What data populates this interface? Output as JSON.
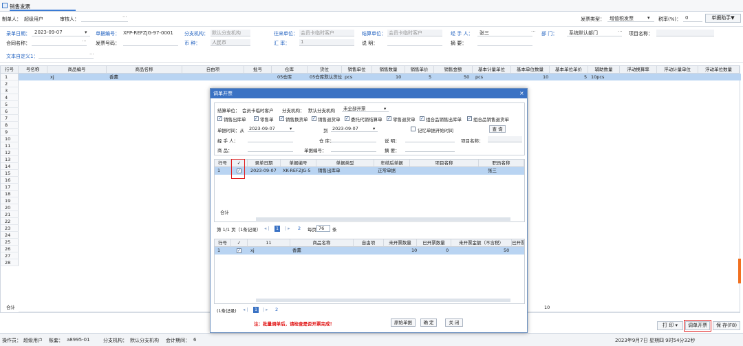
{
  "window": {
    "title": "销售发票"
  },
  "header": {
    "maker_label": "制单人：",
    "maker_value": "超级用户",
    "auditor_label": "审核人：",
    "invoice_type_label": "发票类型：",
    "invoice_type_value": "增值税发票",
    "tax_label": "税率(%)：",
    "tax_value": "0",
    "assist_btn": "单据助手▼"
  },
  "form": {
    "record_date_label": "录单日期：",
    "record_date_value": "2023-09-07",
    "doc_no_label": "单据编号：",
    "doc_no_value": "XFP-REFZJG-97-0001",
    "branch_label": "分支机构：",
    "branch_value": "默认分支机构",
    "partner_label": "往来单位：",
    "partner_value": "会员卡临时客户",
    "settle_label": "结算单位：",
    "settle_value": "会员卡临时客户",
    "handler_label": "经 手 人：",
    "handler_value": "张三",
    "dept_label": "部 门：",
    "dept_value": "系统默认部门",
    "project_label": "项目名称：",
    "contract_label": "合同名称：",
    "invoice_no_label": "发票号码：",
    "currency_label": "币 种：",
    "currency_value": "人民币",
    "rate_label": "汇 率：",
    "rate_value": "1",
    "note_label": "说 明：",
    "summary_label": "摘 要：",
    "custom_label": "文本自定义1："
  },
  "grid": {
    "headers": [
      "行号",
      "号名称",
      "商品编号",
      "商品名称",
      "自由项",
      "批号",
      "仓库",
      "货位",
      "销售单位",
      "销售数量",
      "销售单价",
      "销售金额",
      "基本计量单位",
      "基本单位数量",
      "基本单位单价",
      "辅助数量",
      "浮动换算率",
      "浮动计量单位",
      "浮动单位数量"
    ],
    "row1": {
      "n": "1",
      "code": "xj",
      "name": "香薰",
      "wh": "05仓库",
      "loc": "05仓库默认货位",
      "unit": "pcs",
      "qty": "10",
      "price": "5",
      "amt": "50",
      "bunit": "pcs",
      "bqty": "10",
      "bprice": "5",
      "aux": "10pcs"
    },
    "row_numbers": [
      "1",
      "2",
      "3",
      "4",
      "5",
      "6",
      "7",
      "8",
      "9",
      "10",
      "11",
      "12",
      "13",
      "14",
      "15",
      "16",
      "17",
      "18",
      "19",
      "20",
      "21",
      "22",
      "23",
      "24",
      "25",
      "26",
      "27",
      "28"
    ],
    "total_label": "合计",
    "total_qty": "10"
  },
  "dialog": {
    "title": "调单开票",
    "close": "×",
    "settle_label": "结算单位：",
    "settle_value": "会员卡临时客户",
    "branch_label": "分支机构：",
    "branch_value": "默认分支机构",
    "status_value": "未全部开票",
    "checks": [
      "销售出库单",
      "零售单",
      "销售换货单",
      "销售退货单",
      "委托代销结算单",
      "零售退货单",
      "组合品销售出库单",
      "组合品销售退货单"
    ],
    "date_from_label": "单据时间：从",
    "date_from": "2023-09-07",
    "date_to_label": "到",
    "date_to": "2023-09-07",
    "remember_label": "记忆单据开始时间",
    "query_btn": "查 询",
    "handler_label": "经 手 人：",
    "wh_label": "仓 库：",
    "note_label": "说 明：",
    "project_label": "项目名称：",
    "goods_label": "商 品：",
    "docno_label": "单据编号：",
    "summary_label": "摘 要：",
    "t1_headers": [
      "行号",
      "✓",
      "录单日期",
      "单据编号",
      "单据类型",
      "年结后单据",
      "项目名称",
      "职员名称"
    ],
    "t1_row": {
      "n": "1",
      "date": "2023-09-07",
      "no": "XK-REFZJG-5",
      "type": "销售出库单",
      "flag": "正常单据",
      "emp": "张三"
    },
    "t1_total": "合计",
    "pager1": "第 1/1 页（1条记录）",
    "page_num": "1",
    "page_size_label": "每页",
    "page_size": "76",
    "page_unit": "条",
    "pager_skip": "2",
    "t2_headers": [
      "行号",
      "✓",
      "11",
      "商品名称",
      "自由项",
      "未开票数量",
      "已开票数量",
      "未开票金额（不含税）",
      "已开票"
    ],
    "t2_row": {
      "n": "1",
      "code": "xj",
      "name": "香薰",
      "unqty": "10",
      "qty": "0",
      "unamt": "50"
    },
    "pager2": "(1条记录)",
    "warning": "注：批量调单后，请检查是否开票完成！",
    "btn_origin": "原始单据",
    "btn_ok": "确 定",
    "btn_close": "关 闭"
  },
  "actions": {
    "print_btn": "打 印 ▾",
    "invoice_btn": "调单开票",
    "save_btn": "保 存(F8)"
  },
  "status": {
    "operator_label": "操作员：",
    "operator": "超级用户",
    "account_label": "账套：",
    "account": "a8995-01",
    "branch_label": "分支机构：",
    "branch": "默认分支机构",
    "period_label": "会计期间：",
    "period": "6",
    "datetime": "2023年9月7日 星期四 9时54分32秒"
  }
}
